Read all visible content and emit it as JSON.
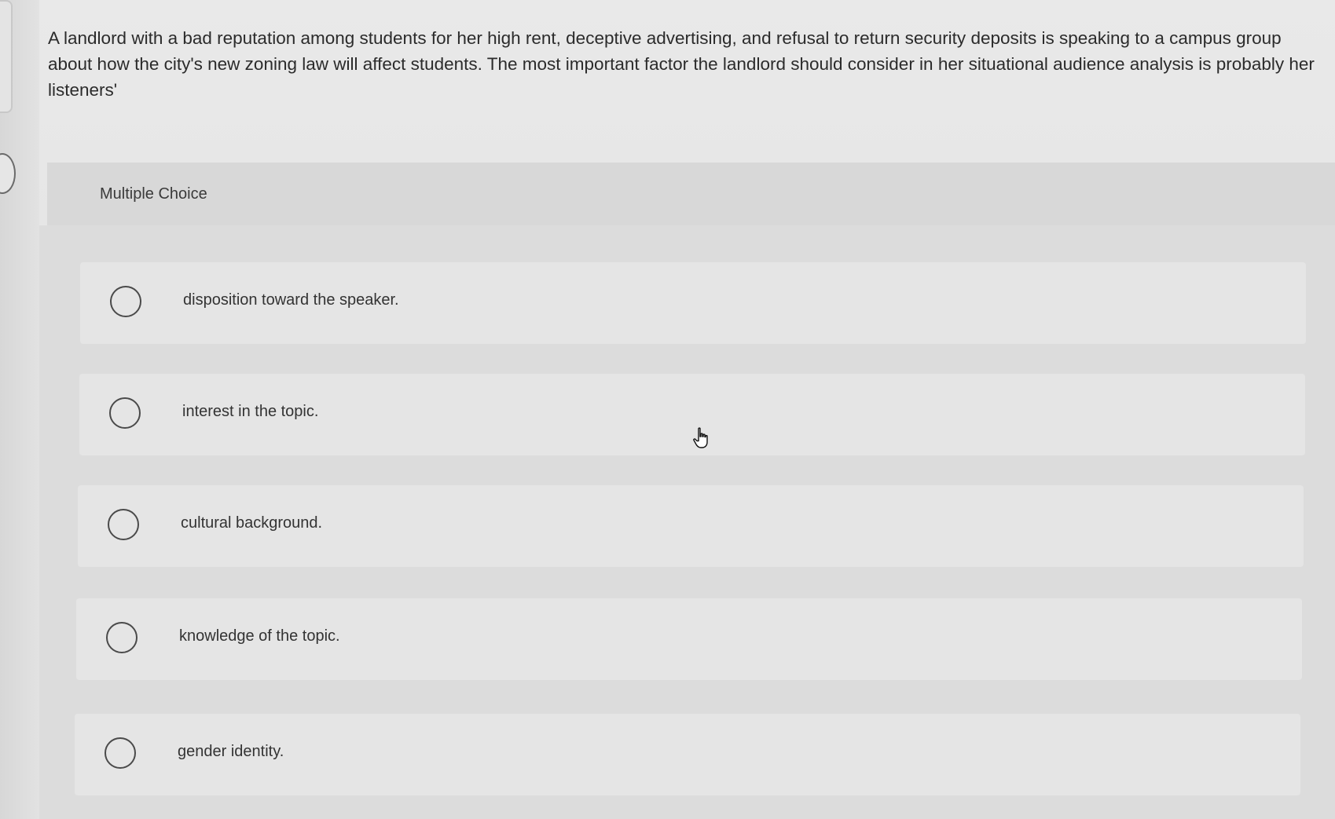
{
  "question": {
    "text": "A landlord with a bad reputation among students for her high rent, deceptive advertising, and refusal to return security deposits is speaking to a campus group about how the city's new zoning law will affect students. The most important factor the landlord should consider in her situational audience analysis is probably her listeners'"
  },
  "question_type": {
    "label": "Multiple Choice"
  },
  "choices": [
    {
      "label": "disposition toward the speaker."
    },
    {
      "label": "interest in the topic."
    },
    {
      "label": "cultural background."
    },
    {
      "label": "knowledge of the topic."
    },
    {
      "label": "gender identity."
    }
  ],
  "cursor": {
    "icon": "hand-pointer-icon"
  }
}
